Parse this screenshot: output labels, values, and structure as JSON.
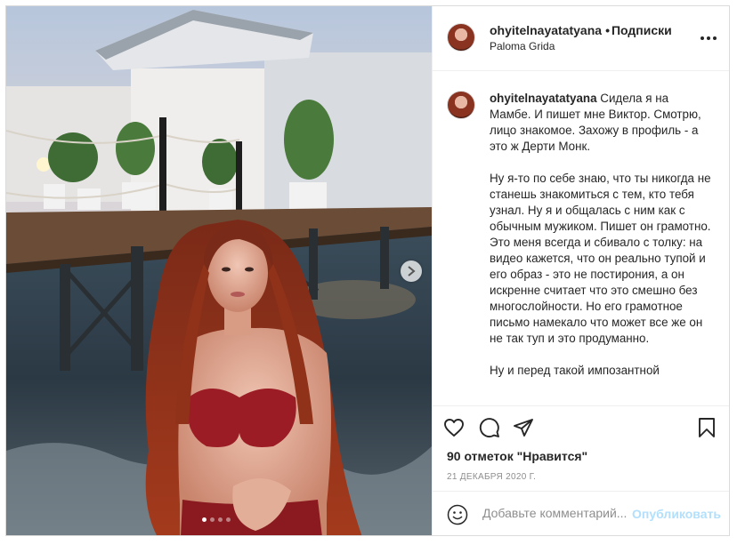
{
  "post": {
    "username": "ohyitelnayatatyana",
    "separator": "•",
    "follow_label": "Подписки",
    "location": "Paloma Grida",
    "more_icon": "more-horizontal-icon"
  },
  "caption": {
    "username": "ohyitelnayatatyana",
    "text": " Сидела я на Мамбе. И пишет мне Виктор. Смотрю, лицо знакомое. Захожу в профиль - а это ж Дерти Монк.\n\nНу я-то по себе знаю, что ты никогда не станешь знакомиться с тем, кто тебя узнал. Ну я и общалась с ним как с обычным мужиком. Пишет он грамотно. Это меня всегда и сбивало с толку: на видео кажется, что он реально тупой и его образ - это не постирония, а он искренне считает что это смешно без многослойности. Но его грамотное письмо намекало что может все же он не так туп и это продуманно.\n\nНу и перед такой импозантной"
  },
  "actions": {
    "like_icon": "heart-icon",
    "comment_icon": "comment-icon",
    "share_icon": "share-icon",
    "save_icon": "bookmark-icon",
    "likes_text": "90 отметок \"Нравится\"",
    "date_text": "21 ДЕКАБРЯ 2020 Г."
  },
  "comment": {
    "emoji_icon": "smiley-icon",
    "placeholder": "Добавьте комментарий...",
    "post_label": "Опубликовать"
  },
  "carousel": {
    "next_icon": "chevron-right-icon",
    "slide_count": 4,
    "current_slide": 1
  },
  "colors": {
    "text": "#262626",
    "muted": "#8e8e8e",
    "border": "#dbdbdb",
    "post_button_disabled": "#b2dffc"
  }
}
